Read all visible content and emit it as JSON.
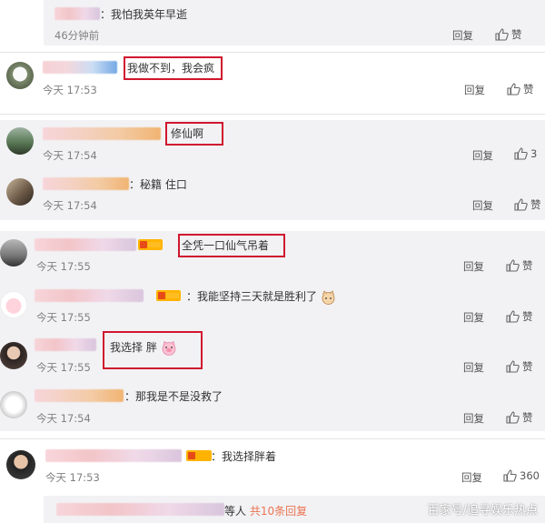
{
  "ui": {
    "reply_label": "回复",
    "like_label": "赞"
  },
  "comments": [
    {
      "text": "：我怕我英年早逝",
      "time": "46分钟前",
      "likes": "赞"
    },
    {
      "text": "我做不到，我会疯",
      "time": "今天 17:53",
      "likes": "赞"
    },
    {
      "text": "修仙啊",
      "time": "今天 17:54",
      "likes": "3"
    },
    {
      "text": "：秘籍  住口",
      "time": "今天 17:54",
      "likes": "赞"
    },
    {
      "text": "全凭一口仙气吊着",
      "time": "今天 17:55",
      "likes": "赞"
    },
    {
      "text": "：我能坚持三天就是胜利了",
      "time": "今天 17:55",
      "likes": "赞"
    },
    {
      "text": "我选择 胖",
      "time": "今天 17:55",
      "likes": "赞"
    },
    {
      "text": "：那我是不是没救了",
      "time": "今天 17:54",
      "likes": "赞"
    },
    {
      "text": "：我选择胖着",
      "time": "今天 17:53",
      "likes": "360"
    }
  ],
  "footer": {
    "suffix": "等人",
    "more_replies": "共10条回复"
  },
  "watermark": "百家号/追寻娱乐热点",
  "colors": {
    "highlight_box": "#d0162e",
    "link": "#eb7350",
    "panel_bg": "#f2f2f5"
  }
}
